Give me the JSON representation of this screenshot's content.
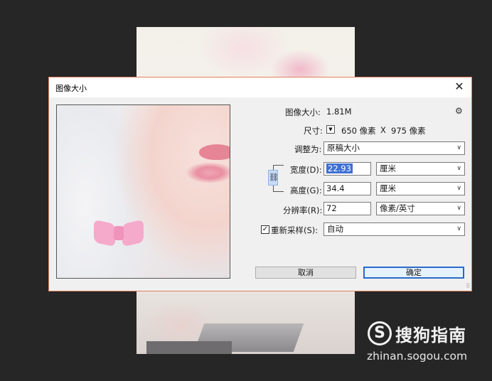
{
  "dialog": {
    "title": "图像大小",
    "close_glyph": "✕",
    "image_size_label": "图像大小:",
    "image_size_value": "1.81M",
    "dimensions_label": "尺寸:",
    "dimensions_width": "650 像素",
    "dimensions_x": "X",
    "dimensions_height": "975 像素",
    "fit_to_label": "调整为:",
    "fit_to_value": "原稿大小",
    "width_label": "宽度(D):",
    "width_value": "22.93",
    "width_unit": "厘米",
    "height_label": "高度(G):",
    "height_value": "34.4",
    "height_unit": "厘米",
    "resolution_label": "分辨率(R):",
    "resolution_value": "72",
    "resolution_unit": "像素/英寸",
    "resample_label": "重新采样(S):",
    "resample_checked": true,
    "resample_value": "自动",
    "cancel_label": "取消",
    "ok_label": "确定",
    "icons": {
      "gear": "gear-icon",
      "dropdown": "chevron-down-icon",
      "link": "link-icon",
      "close": "close-icon"
    }
  },
  "watermark": {
    "logo_letter": "S",
    "name": "搜狗指南",
    "url": "zhinan.sogou.com"
  },
  "colors": {
    "background": "#262626",
    "dialog_border": "#e0805f",
    "selection": "#3e6fd4",
    "primary_border": "#2a6acb"
  }
}
